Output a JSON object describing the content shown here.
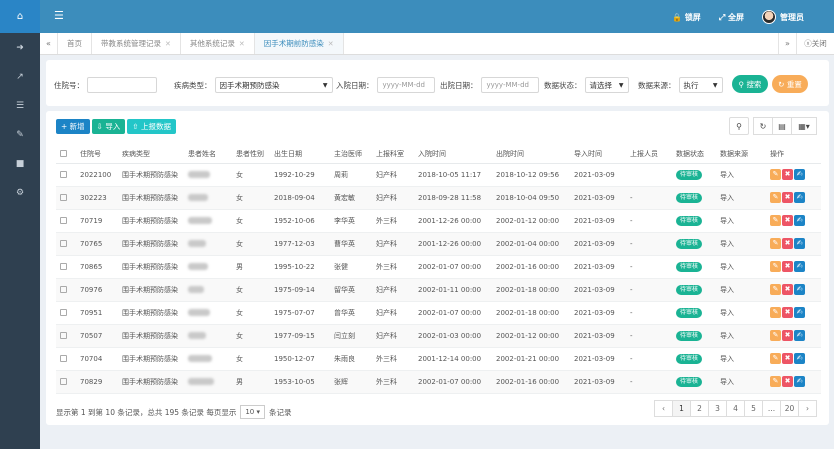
{
  "topbar": {
    "fullscreen_label": "全屏",
    "lock_label": "锁屏",
    "username": "管理员"
  },
  "tabs": [
    {
      "label": "首页"
    },
    {
      "label": "带教系统管理记录"
    },
    {
      "label": "其他系统记录"
    },
    {
      "label": "因手术期前防感染"
    }
  ],
  "tabbar": {
    "close_label": "关闭"
  },
  "filters": {
    "id_label": "住院号：",
    "id_value": "",
    "type_label": "疾病类型：",
    "type_value": "因手术期预防感染",
    "admit_label": "入院日期：",
    "admit_placeholder": "yyyy-MM-dd",
    "discharge_label": "出院日期：",
    "discharge_placeholder": "yyyy-MM-dd",
    "status_label": "数据状态：",
    "status_value": "请选择",
    "source_label": "数据来源：",
    "source_value": "执行",
    "search_label": "搜索",
    "reset_label": "重置"
  },
  "toolbar": {
    "add_label": "新增",
    "import_label": "导入",
    "upload_label": "上报数据"
  },
  "table": {
    "headers": [
      "",
      "住院号",
      "疾病类型",
      "患者姓名",
      "患者性别",
      "出生日期",
      "主治医师",
      "上报科室",
      "入院时间",
      "出院时间",
      "导入时间",
      "上报人员",
      "数据状态",
      "数据来源",
      "操作"
    ],
    "rows": [
      [
        "2022100",
        "围手术期预防感染",
        "女",
        "1992-10-29",
        "周莉",
        "妇产科",
        "2018-10-05 11:17",
        "2018-10-12 09:56",
        "2021-03-09",
        "",
        "待审核",
        "导入"
      ],
      [
        "302223",
        "围手术期预防感染",
        "女",
        "2018-09-04",
        "黄宏敏",
        "妇产科",
        "2018-09-28 11:58",
        "2018-10-04 09:50",
        "2021-03-09",
        "-",
        "待审核",
        "导入"
      ],
      [
        "70719",
        "围手术期预防感染",
        "女",
        "1952-10-06",
        "李华英",
        "外三科",
        "2001-12-26 00:00",
        "2002-01-12 00:00",
        "2021-03-09",
        "-",
        "待审核",
        "导入"
      ],
      [
        "70765",
        "围手术期预防感染",
        "女",
        "1977-12-03",
        "曹华英",
        "妇产科",
        "2001-12-26 00:00",
        "2002-01-04 00:00",
        "2021-03-09",
        "-",
        "待审核",
        "导入"
      ],
      [
        "70865",
        "围手术期预防感染",
        "男",
        "1995-10-22",
        "张健",
        "外三科",
        "2002-01-07 00:00",
        "2002-01-16 00:00",
        "2021-03-09",
        "-",
        "待审核",
        "导入"
      ],
      [
        "70976",
        "围手术期预防感染",
        "女",
        "1975-09-14",
        "留华英",
        "妇产科",
        "2002-01-11 00:00",
        "2002-01-18 00:00",
        "2021-03-09",
        "-",
        "待审核",
        "导入"
      ],
      [
        "70951",
        "围手术期预防感染",
        "女",
        "1975-07-07",
        "曾华英",
        "妇产科",
        "2002-01-07 00:00",
        "2002-01-18 00:00",
        "2021-03-09",
        "-",
        "待审核",
        "导入"
      ],
      [
        "70507",
        "围手术期预防感染",
        "女",
        "1977-09-15",
        "闫立刻",
        "妇产科",
        "2002-01-03 00:00",
        "2002-01-12 00:00",
        "2021-03-09",
        "-",
        "待审核",
        "导入"
      ],
      [
        "70704",
        "围手术期预防感染",
        "女",
        "1950-12-07",
        "朱雨良",
        "外三科",
        "2001-12-14 00:00",
        "2002-01-21 00:00",
        "2021-03-09",
        "-",
        "待审核",
        "导入"
      ],
      [
        "70829",
        "围手术期预防感染",
        "男",
        "1953-10-05",
        "张辉",
        "外三科",
        "2002-01-07 00:00",
        "2002-01-16 00:00",
        "2021-03-09",
        "-",
        "待审核",
        "导入"
      ]
    ]
  },
  "footer": {
    "info_prefix": "显示第 1 到第 10 条记录，总共 195 条记录 每页显示",
    "page_size": "10",
    "info_suffix": "条记录"
  },
  "pagination": [
    "‹",
    "1",
    "2",
    "3",
    "4",
    "5",
    "...",
    "20",
    "›"
  ],
  "colors": {
    "sidebar": "#2f4050",
    "topbar": "#3c8dbc",
    "primary": "#1c84c6",
    "success": "#1ab394",
    "warning": "#f8ac59",
    "danger": "#ed5565"
  }
}
